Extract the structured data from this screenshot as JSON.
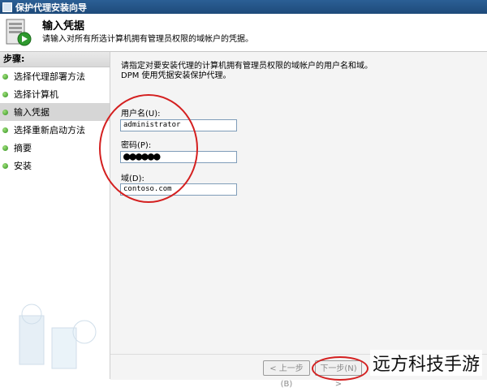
{
  "window": {
    "title": "保护代理安装向导"
  },
  "header": {
    "title": "输入凭据",
    "subtitle": "请输入对所有所选计算机拥有管理员权限的域帐户的凭据。"
  },
  "steps": {
    "heading": "步骤:",
    "items": [
      {
        "label": "选择代理部署方法"
      },
      {
        "label": "选择计算机"
      },
      {
        "label": "输入凭据"
      },
      {
        "label": "选择重新启动方法"
      },
      {
        "label": "摘要"
      },
      {
        "label": "安装"
      }
    ]
  },
  "main": {
    "description_line1": "请指定对要安装代理的计算机拥有管理员权限的域帐户的用户名和域。",
    "description_line2": "DPM 使用凭据安装保护代理。",
    "username": {
      "label": "用户名(U):",
      "value": "administrator"
    },
    "password": {
      "label": "密码(P):",
      "value": "●●●●●●"
    },
    "domain": {
      "label": "域(D):",
      "value": "contoso.com"
    }
  },
  "footer": {
    "back_label": "< 上一步(B)",
    "next_label": "下一步(N) >"
  },
  "watermark": "远方科技手游",
  "colors": {
    "annotation": "#d42020",
    "titlebar": "#2b5f95"
  }
}
